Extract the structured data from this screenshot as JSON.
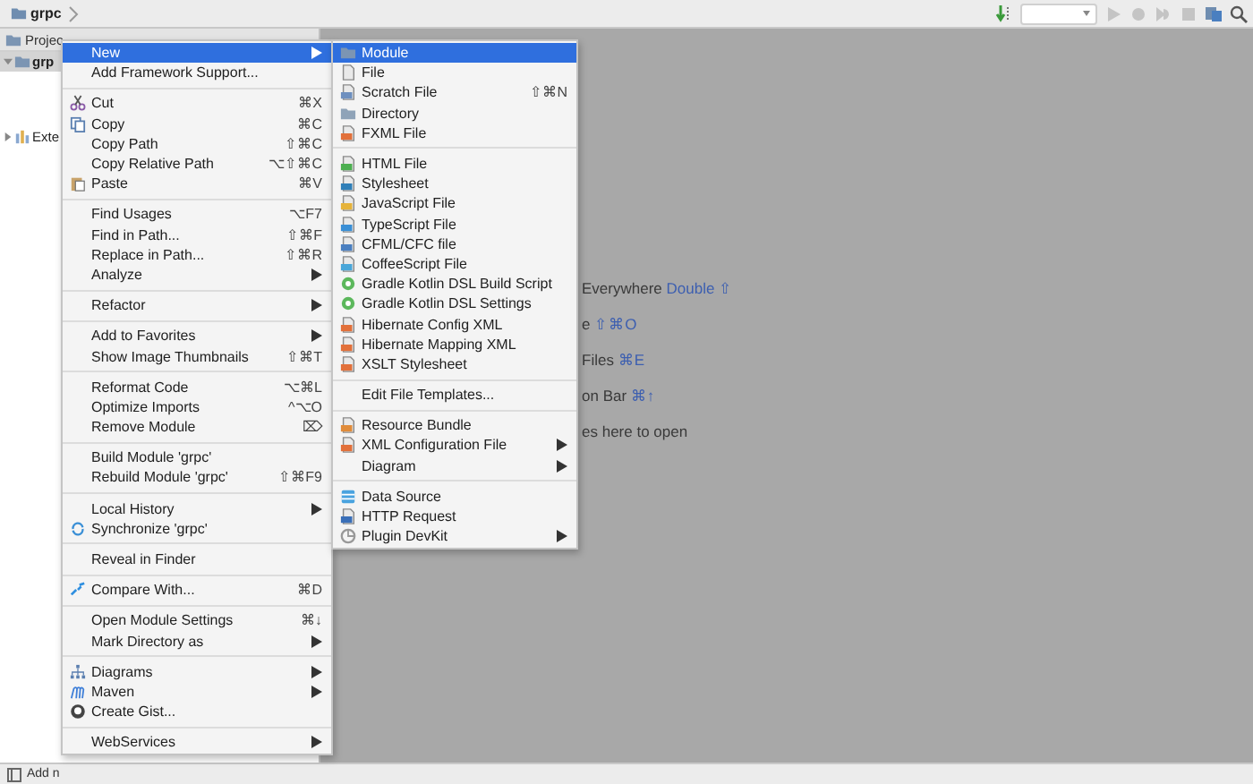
{
  "navigation_bar": {
    "breadcrumb": "grpc"
  },
  "project_panel": {
    "title": "Projec",
    "tree": [
      {
        "label": "grp",
        "selected": true
      },
      {
        "label": "Exte",
        "selected": false
      }
    ]
  },
  "editor_hints": [
    {
      "text": "Everywhere",
      "shortcut": "Double ⇧"
    },
    {
      "text": "e",
      "shortcut": "⇧⌘O"
    },
    {
      "text": "Files",
      "shortcut": "⌘E"
    },
    {
      "text": "on Bar",
      "shortcut": "⌘↑"
    },
    {
      "text": "es here to open"
    }
  ],
  "status_bar": {
    "text": "Add n"
  },
  "context_menu": {
    "groups": [
      {
        "items": [
          {
            "label": "New",
            "submenu": true,
            "selected": true
          },
          {
            "label": "Add Framework Support...",
            "selected": false
          }
        ]
      },
      {
        "items": [
          {
            "label": "Cut",
            "shortcut": "⌘X",
            "selected": false
          },
          {
            "label": "Copy",
            "shortcut": "⌘C",
            "selected": false
          },
          {
            "label": "Copy Path",
            "shortcut": "⇧⌘C",
            "selected": false
          },
          {
            "label": "Copy Relative Path",
            "shortcut": "⌥⇧⌘C",
            "selected": false
          },
          {
            "label": "Paste",
            "shortcut": "⌘V",
            "selected": false
          }
        ]
      },
      {
        "items": [
          {
            "label": "Find Usages",
            "shortcut": "⌥F7",
            "selected": false
          },
          {
            "label": "Find in Path...",
            "shortcut": "⇧⌘F",
            "selected": false
          },
          {
            "label": "Replace in Path...",
            "shortcut": "⇧⌘R",
            "selected": false
          },
          {
            "label": "Analyze",
            "submenu": true,
            "selected": false
          }
        ]
      },
      {
        "items": [
          {
            "label": "Refactor",
            "submenu": true,
            "selected": false
          }
        ]
      },
      {
        "items": [
          {
            "label": "Add to Favorites",
            "submenu": true,
            "selected": false
          },
          {
            "label": "Show Image Thumbnails",
            "shortcut": "⇧⌘T",
            "selected": false
          }
        ]
      },
      {
        "items": [
          {
            "label": "Reformat Code",
            "shortcut": "⌥⌘L",
            "selected": false
          },
          {
            "label": "Optimize Imports",
            "shortcut": "^⌥O",
            "selected": false
          },
          {
            "label": "Remove Module",
            "shortcut": "⌦",
            "selected": false
          }
        ]
      },
      {
        "items": [
          {
            "label": "Build Module 'grpc'",
            "selected": false
          },
          {
            "label": "Rebuild Module 'grpc'",
            "shortcut": "⇧⌘F9",
            "selected": false
          }
        ]
      },
      {
        "items": [
          {
            "label": "Local History",
            "submenu": true,
            "selected": false
          },
          {
            "label": "Synchronize 'grpc'",
            "selected": false
          }
        ]
      },
      {
        "items": [
          {
            "label": "Reveal in Finder",
            "selected": false
          }
        ]
      },
      {
        "items": [
          {
            "label": "Compare With...",
            "shortcut": "⌘D",
            "selected": false
          }
        ]
      },
      {
        "items": [
          {
            "label": "Open Module Settings",
            "shortcut": "⌘↓",
            "selected": false
          },
          {
            "label": "Mark Directory as",
            "submenu": true,
            "selected": false
          }
        ]
      },
      {
        "items": [
          {
            "label": "Diagrams",
            "submenu": true,
            "selected": false
          },
          {
            "label": "Maven",
            "submenu": true,
            "selected": false
          },
          {
            "label": "Create Gist...",
            "selected": false
          }
        ]
      },
      {
        "items": [
          {
            "label": "WebServices",
            "submenu": true,
            "selected": false
          }
        ]
      }
    ]
  },
  "new_submenu": {
    "groups": [
      {
        "items": [
          {
            "label": "Module",
            "selected": true
          },
          {
            "label": "File",
            "selected": false
          },
          {
            "label": "Scratch File",
            "shortcut": "⇧⌘N",
            "selected": false
          },
          {
            "label": "Directory",
            "selected": false
          },
          {
            "label": "FXML File",
            "selected": false
          }
        ]
      },
      {
        "items": [
          {
            "label": "HTML File",
            "selected": false
          },
          {
            "label": "Stylesheet",
            "selected": false
          },
          {
            "label": "JavaScript File",
            "selected": false
          },
          {
            "label": "TypeScript File",
            "selected": false
          },
          {
            "label": "CFML/CFC file",
            "selected": false
          },
          {
            "label": "CoffeeScript File",
            "selected": false
          },
          {
            "label": "Gradle Kotlin DSL Build Script",
            "selected": false
          },
          {
            "label": "Gradle Kotlin DSL Settings",
            "selected": false
          },
          {
            "label": "Hibernate Config XML",
            "selected": false
          },
          {
            "label": "Hibernate Mapping XML",
            "selected": false
          },
          {
            "label": "XSLT Stylesheet",
            "selected": false
          }
        ]
      },
      {
        "items": [
          {
            "label": "Edit File Templates...",
            "selected": false
          }
        ]
      },
      {
        "items": [
          {
            "label": "Resource Bundle",
            "selected": false
          },
          {
            "label": "XML Configuration File",
            "submenu": true,
            "selected": false
          },
          {
            "label": "Diagram",
            "submenu": true,
            "selected": false
          }
        ]
      },
      {
        "items": [
          {
            "label": "Data Source",
            "selected": false
          },
          {
            "label": "HTTP Request",
            "selected": false
          },
          {
            "label": "Plugin DevKit",
            "submenu": true,
            "selected": false
          }
        ]
      }
    ]
  }
}
